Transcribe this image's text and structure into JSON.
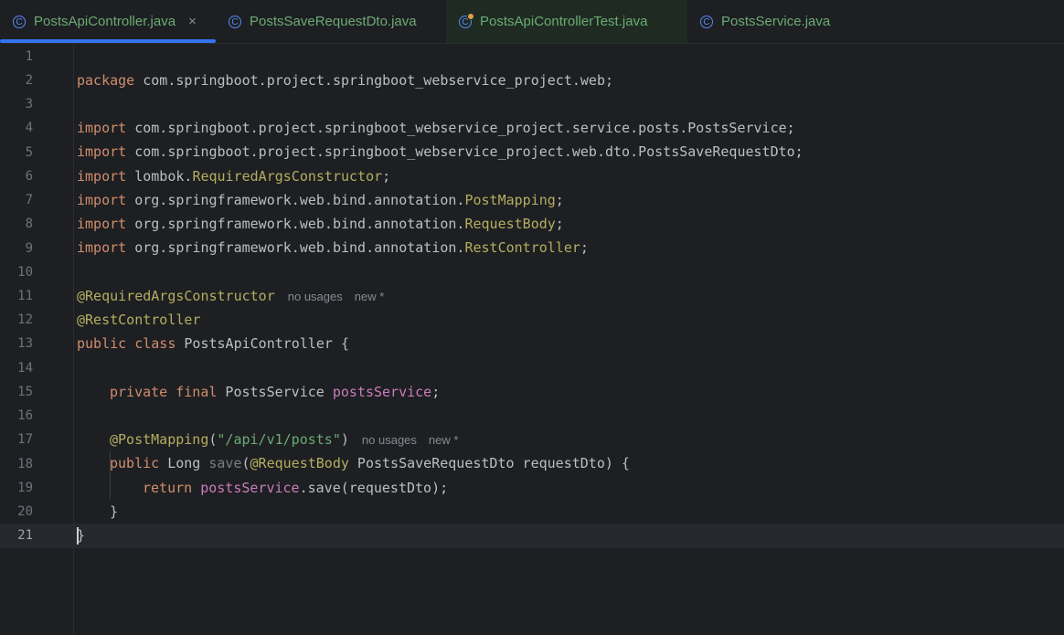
{
  "tabs": [
    {
      "label": "PostsApiController.java",
      "icon": "java-class-icon",
      "active": true
    },
    {
      "label": "PostsSaveRequestDto.java",
      "icon": "java-class-icon"
    },
    {
      "label": "PostsApiControllerTest.java",
      "icon": "java-test-class-icon"
    },
    {
      "label": "PostsService.java",
      "icon": "java-class-icon"
    }
  ],
  "close_glyph": "×",
  "editor": {
    "line_numbers": [
      "1",
      "2",
      "3",
      "4",
      "5",
      "6",
      "7",
      "8",
      "9",
      "10",
      "11",
      "12",
      "13",
      "14",
      "15",
      "16",
      "17",
      "18",
      "19",
      "20",
      "21"
    ],
    "current_line": "21",
    "lines": {
      "l1": {
        "kw": "package",
        "rest": " com.springboot.project.springboot_webservice_project.web;"
      },
      "l3": {
        "kw": "import",
        "rest": " com.springboot.project.springboot_webservice_project.service.posts.PostsService;"
      },
      "l4": {
        "kw": "import",
        "rest": " com.springboot.project.springboot_webservice_project.web.dto.PostsSaveRequestDto;"
      },
      "l5": {
        "kw": "import",
        "pre": " lombok.",
        "ann": "RequiredArgsConstructor",
        "end": ";"
      },
      "l6": {
        "kw": "import",
        "pre": " org.springframework.web.bind.annotation.",
        "ann": "PostMapping",
        "end": ";"
      },
      "l7": {
        "kw": "import",
        "pre": " org.springframework.web.bind.annotation.",
        "ann": "RequestBody",
        "end": ";"
      },
      "l8": {
        "kw": "import",
        "pre": " org.springframework.web.bind.annotation.",
        "ann": "RestController",
        "end": ";"
      },
      "l10": {
        "ann": "@RequiredArgsConstructor",
        "hint1": "no usages",
        "hint2": "new *"
      },
      "l11": {
        "ann": "@RestController"
      },
      "l12": {
        "kw1": "public",
        "kw2": "class",
        "rest": " PostsApiController {"
      },
      "l14": {
        "kw1": "private",
        "kw2": "final",
        "type": " PostsService ",
        "field": "postsService",
        "end": ";"
      },
      "l16": {
        "ann": "@PostMapping",
        "open": "(",
        "str": "\"/api/v1/posts\"",
        "close": ")",
        "hint1": "no usages",
        "hint2": "new *"
      },
      "l17": {
        "kw": "public",
        "type": " Long ",
        "method": "save",
        "open": "(",
        "ann": "@RequestBody",
        "rest": " PostsSaveRequestDto requestDto) {"
      },
      "l18": {
        "kw": "return",
        "field": "postsService",
        "rest": ".save(requestDto);"
      },
      "l19": {
        "text": "}"
      },
      "l20": {
        "text": "}"
      }
    }
  }
}
